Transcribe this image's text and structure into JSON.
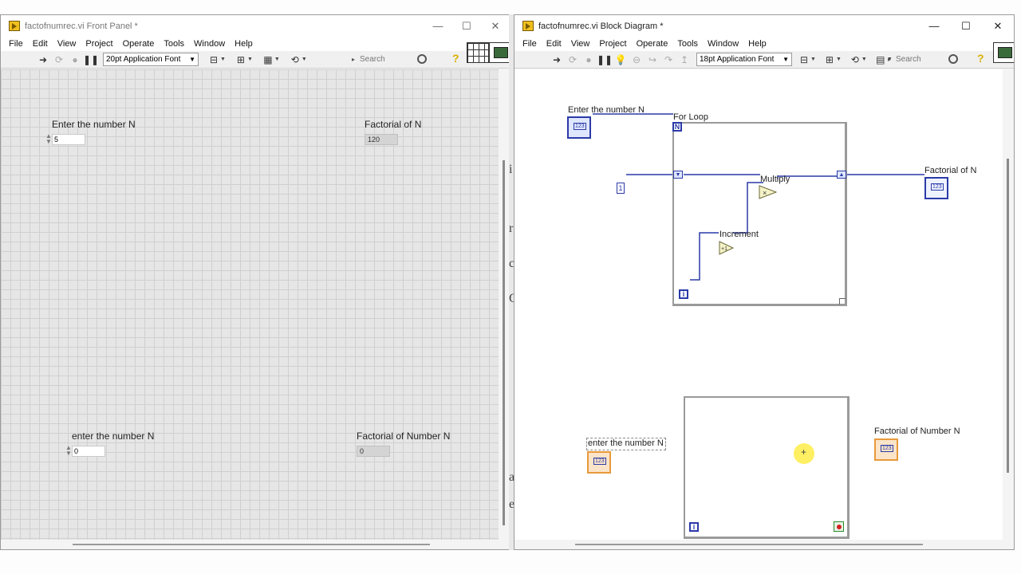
{
  "front_panel": {
    "title": "factofnumrec.vi Front Panel *",
    "window_controls": {
      "minimize": "—",
      "maximize": "☐",
      "close": "✕"
    },
    "menu": [
      "File",
      "Edit",
      "View",
      "Project",
      "Operate",
      "Tools",
      "Window",
      "Help"
    ],
    "toolbar": {
      "font": "20pt Application Font",
      "search_placeholder": "Search"
    },
    "controls": [
      {
        "label": "Enter the number N",
        "value": "5"
      },
      {
        "label": "enter the number N",
        "value": "0"
      }
    ],
    "indicators": [
      {
        "label": "Factorial of N",
        "value": "120"
      },
      {
        "label": "Factorial of Number N",
        "value": "0"
      }
    ]
  },
  "block_diagram": {
    "title": "factofnumrec.vi Block Diagram *",
    "window_controls": {
      "minimize": "—",
      "maximize": "☐",
      "close": "✕"
    },
    "menu": [
      "File",
      "Edit",
      "View",
      "Project",
      "Operate",
      "Tools",
      "Window",
      "Help"
    ],
    "toolbar": {
      "font": "18pt Application Font",
      "search_placeholder": "Search"
    },
    "labels": {
      "enter_n": "Enter the number N",
      "for_loop": "For Loop",
      "factorial_n": "Factorial of N",
      "multiply": "Multiply",
      "increment": "Increment",
      "enter_n_2": "enter the number N",
      "factorial_number_n": "Factorial of Number N"
    },
    "terminals": {
      "count": "N",
      "iteration": "i",
      "iteration_2": "i",
      "constant": "1"
    },
    "node_glyphs": {
      "multiply": "×",
      "increment": "+1"
    }
  },
  "side_glyphs": [
    "i",
    "r",
    "c",
    "C",
    "a",
    "e"
  ]
}
